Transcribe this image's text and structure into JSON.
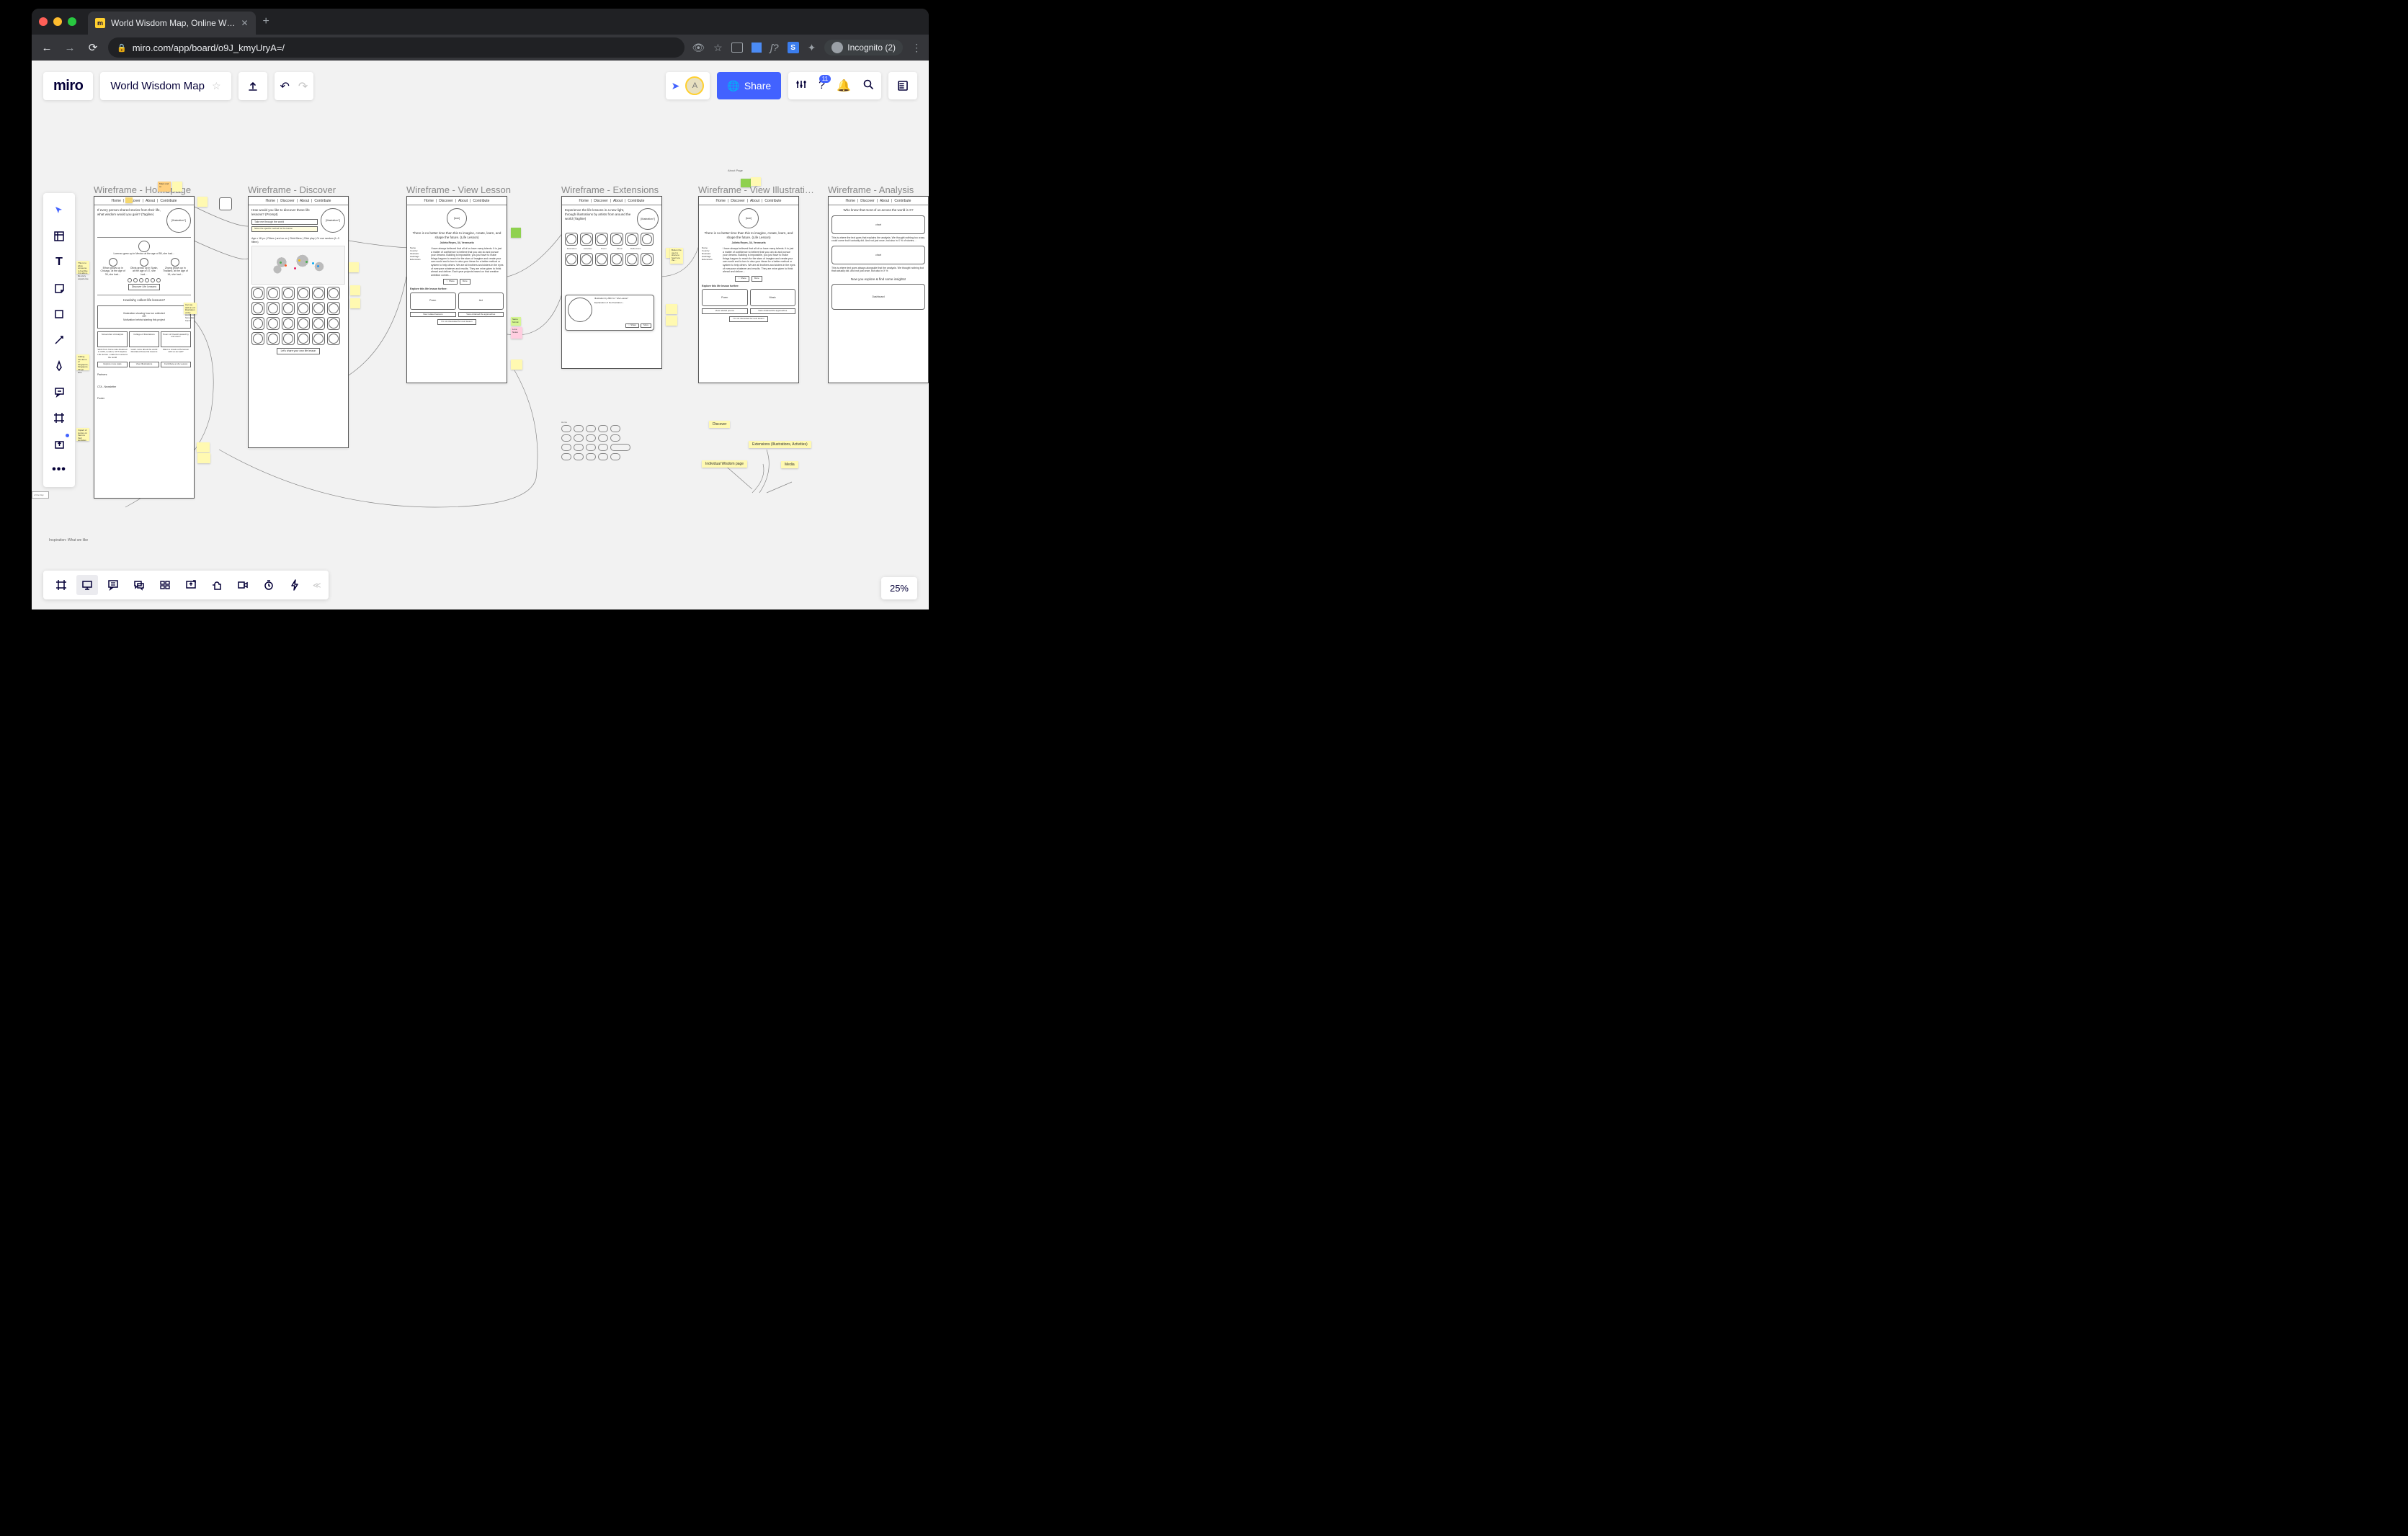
{
  "browser": {
    "tab_title": "World Wisdom Map, Online W…",
    "url": "miro.com/app/board/o9J_kmyUryA=/",
    "incognito_label": "Incognito (2)"
  },
  "app": {
    "logo": "miro",
    "board_name": "World Wisdom Map",
    "share_label": "Share",
    "zoom": "25%",
    "avatar_initial": "A",
    "help_badge": "11"
  },
  "wireframes": {
    "nav": [
      "Home",
      "Discover",
      "About",
      "Contribute"
    ],
    "w1": {
      "title": "Wireframe - Homepage",
      "tagline": "If every person shared stories from their life, what wisdom would you gain? (Tagline)",
      "illus": "[Illustration?]",
      "timeline_a": "Lorenzo grew up in Mexico at the age of 55, she had…",
      "timeline_b": "Ethan grows up in Chicago, at the age of 30, she had…",
      "timeline_c": "Olivia grows up in Spain, at the age of 47, she had…",
      "timeline_d": "Zhang grows up in Thailand, at the age of 16, she had…",
      "discover_btn": "Discover Life Lessons",
      "side_note": "Can we add an ext illustration of the people we have data from?",
      "heading2": "How/why collect life lessons?",
      "motivation": "Illustration showing how we collected\nOR\nMotivation behind starting this project",
      "card1": "Screenshot of Analysis",
      "card2": "Collage of Illustrations",
      "card3": "Poem of Overall viewed by end user?",
      "card1b": "Work from home was dreamed in 1973, London, UK? Explore Life stories + stats from around the world",
      "card2b": "Learn more about the world illustrated these life lessons",
      "card3b": "Want to create a life lesson with us as well?",
      "btn1": "Explore more stats",
      "btn2": "View Illustrations",
      "btn3": "Contribute a Life Lesson",
      "partners": "Partners:",
      "newsletter": "CTA - Newsletter",
      "footer": "Footer"
    },
    "w2": {
      "title": "Wireframe - Discover",
      "prompt": "How would you like to discover these life lessons? (Prompt)",
      "hint": "Take me through the world",
      "illus": "[Illustration?]",
      "subhint": "Show the specific method for the lesson",
      "filter_text": "Age ≥ 18 y.o | Filters | and so on | Click filters | Click play | Or use random (1–3 filters)",
      "share_btn": "Let's share your own life lesson"
    },
    "w3": {
      "title": "Wireframe - View Lesson",
      "icon": "[icon]",
      "lesson": "There is no better time than this to imagine, create, learn, and shape the future. (Life Lesson)",
      "author": "Julieta Reyes, 34, Venezuela",
      "meta_name": "Name",
      "meta_country": "Country",
      "meta_illus": "Illustrator",
      "meta_hashtags": "Hashtags",
      "meta_extensions": "Extensions",
      "body": "I have always believed that all of us have many talents. It is just a matter of confidence to believe that you can do and pursue your dreams. Building is impossible, you just have to make things happen to reach for the stars of imagine and create your own world and to turn in also your ideas for a better method or system to help others. We are all brothers and sisters in the eyes of everyone whatever and results. They are mine given to think ahead and deliver. Each year projects based on that creative ambition comes…",
      "share": "Share",
      "more": "More",
      "explore": "Explore this life lesson further:",
      "poem": "Poem",
      "act": "Act",
      "related": "View related lessons",
      "obtained": "View obtained life approaches",
      "next": "I'm not interested for next lesson"
    },
    "w4": {
      "title": "Wireframe - Extensions",
      "tagline": "Experience the life lessons in a new light, through illustrations by artists from around the world (Tagline)",
      "illus": "[Illustration?]",
      "cats": [
        "Illustration",
        "Activities",
        "Poem",
        "Music",
        "Reflections"
      ],
      "modal_title": "Illustration by ABC for \"Life Lesson\"",
      "modal_sub": "Explanation of the illustration…",
      "modal_share": "Share",
      "modal_more": "More",
      "create": "Create your own illustration"
    },
    "w5": {
      "title": "Wireframe - View Illustrati…",
      "icon": "[icon]",
      "lesson": "There is no better time than this to imagine, create, learn, and shape the future. (Life Lesson)",
      "author": "Julieta Reyes, 34, Venezuela",
      "body": "I have always believed that all of us have many talents. It is just a matter of confidence to believe that you can do and pursue your dreams. Building is impossible, you just have to make things happen to reach for the stars of imagine and create your own world and to turn in also your ideas for a better method or system to help others. We are all brothers and sisters in the eyes of everyone whatever and results. They are mine given to think ahead and deliver…",
      "share": "Share",
      "more": "More",
      "explore": "Explore this life lesson further:",
      "poem": "Poem",
      "music": "Music",
      "related": "View related poems",
      "obtained": "View obtained life approaches",
      "next": "I'm not interested for next lesson"
    },
    "w6": {
      "title": "Wireframe - Analysis",
      "headline": "Who knew that most of us across the world is X?",
      "chart1": "chart",
      "desc1": "This is where the text goes that explains the analysis. We thought nothing too crazy could come but it actually did. And not just once, but also in X % of stories…",
      "chart2": "chart",
      "desc2": "This is where text goes always alongside that the analysis. We thought nothing but that actually did. And not just once, but also in X %",
      "explore": "Now you explore & find some insights!",
      "dashboard": "Dashboard"
    }
  },
  "stickies": {
    "s1": "Maps and so",
    "s2": "",
    "s3": "This is to allow someone to feel like it is also a life story experience",
    "s4": "Adding the demo of Singapore, Singapore things also",
    "s5": "Impact of stories on them to their websites",
    "s6": "",
    "s7": "",
    "s8": "",
    "s9": "",
    "s10": "Same format",
    "s11": "Button the user to share to heart via the…",
    "s12": "Same format",
    "s13": "Love Notes",
    "s14": "",
    "s15": "About Page"
  },
  "mindmap": {
    "n1": "Discover",
    "n2": "Individual Wisdom page",
    "n3": "Extensions (Illustrations, Activities)",
    "n4": "Media"
  },
  "inspiration": "Inspiration: What we like",
  "lesson_of_day": "of the Day"
}
